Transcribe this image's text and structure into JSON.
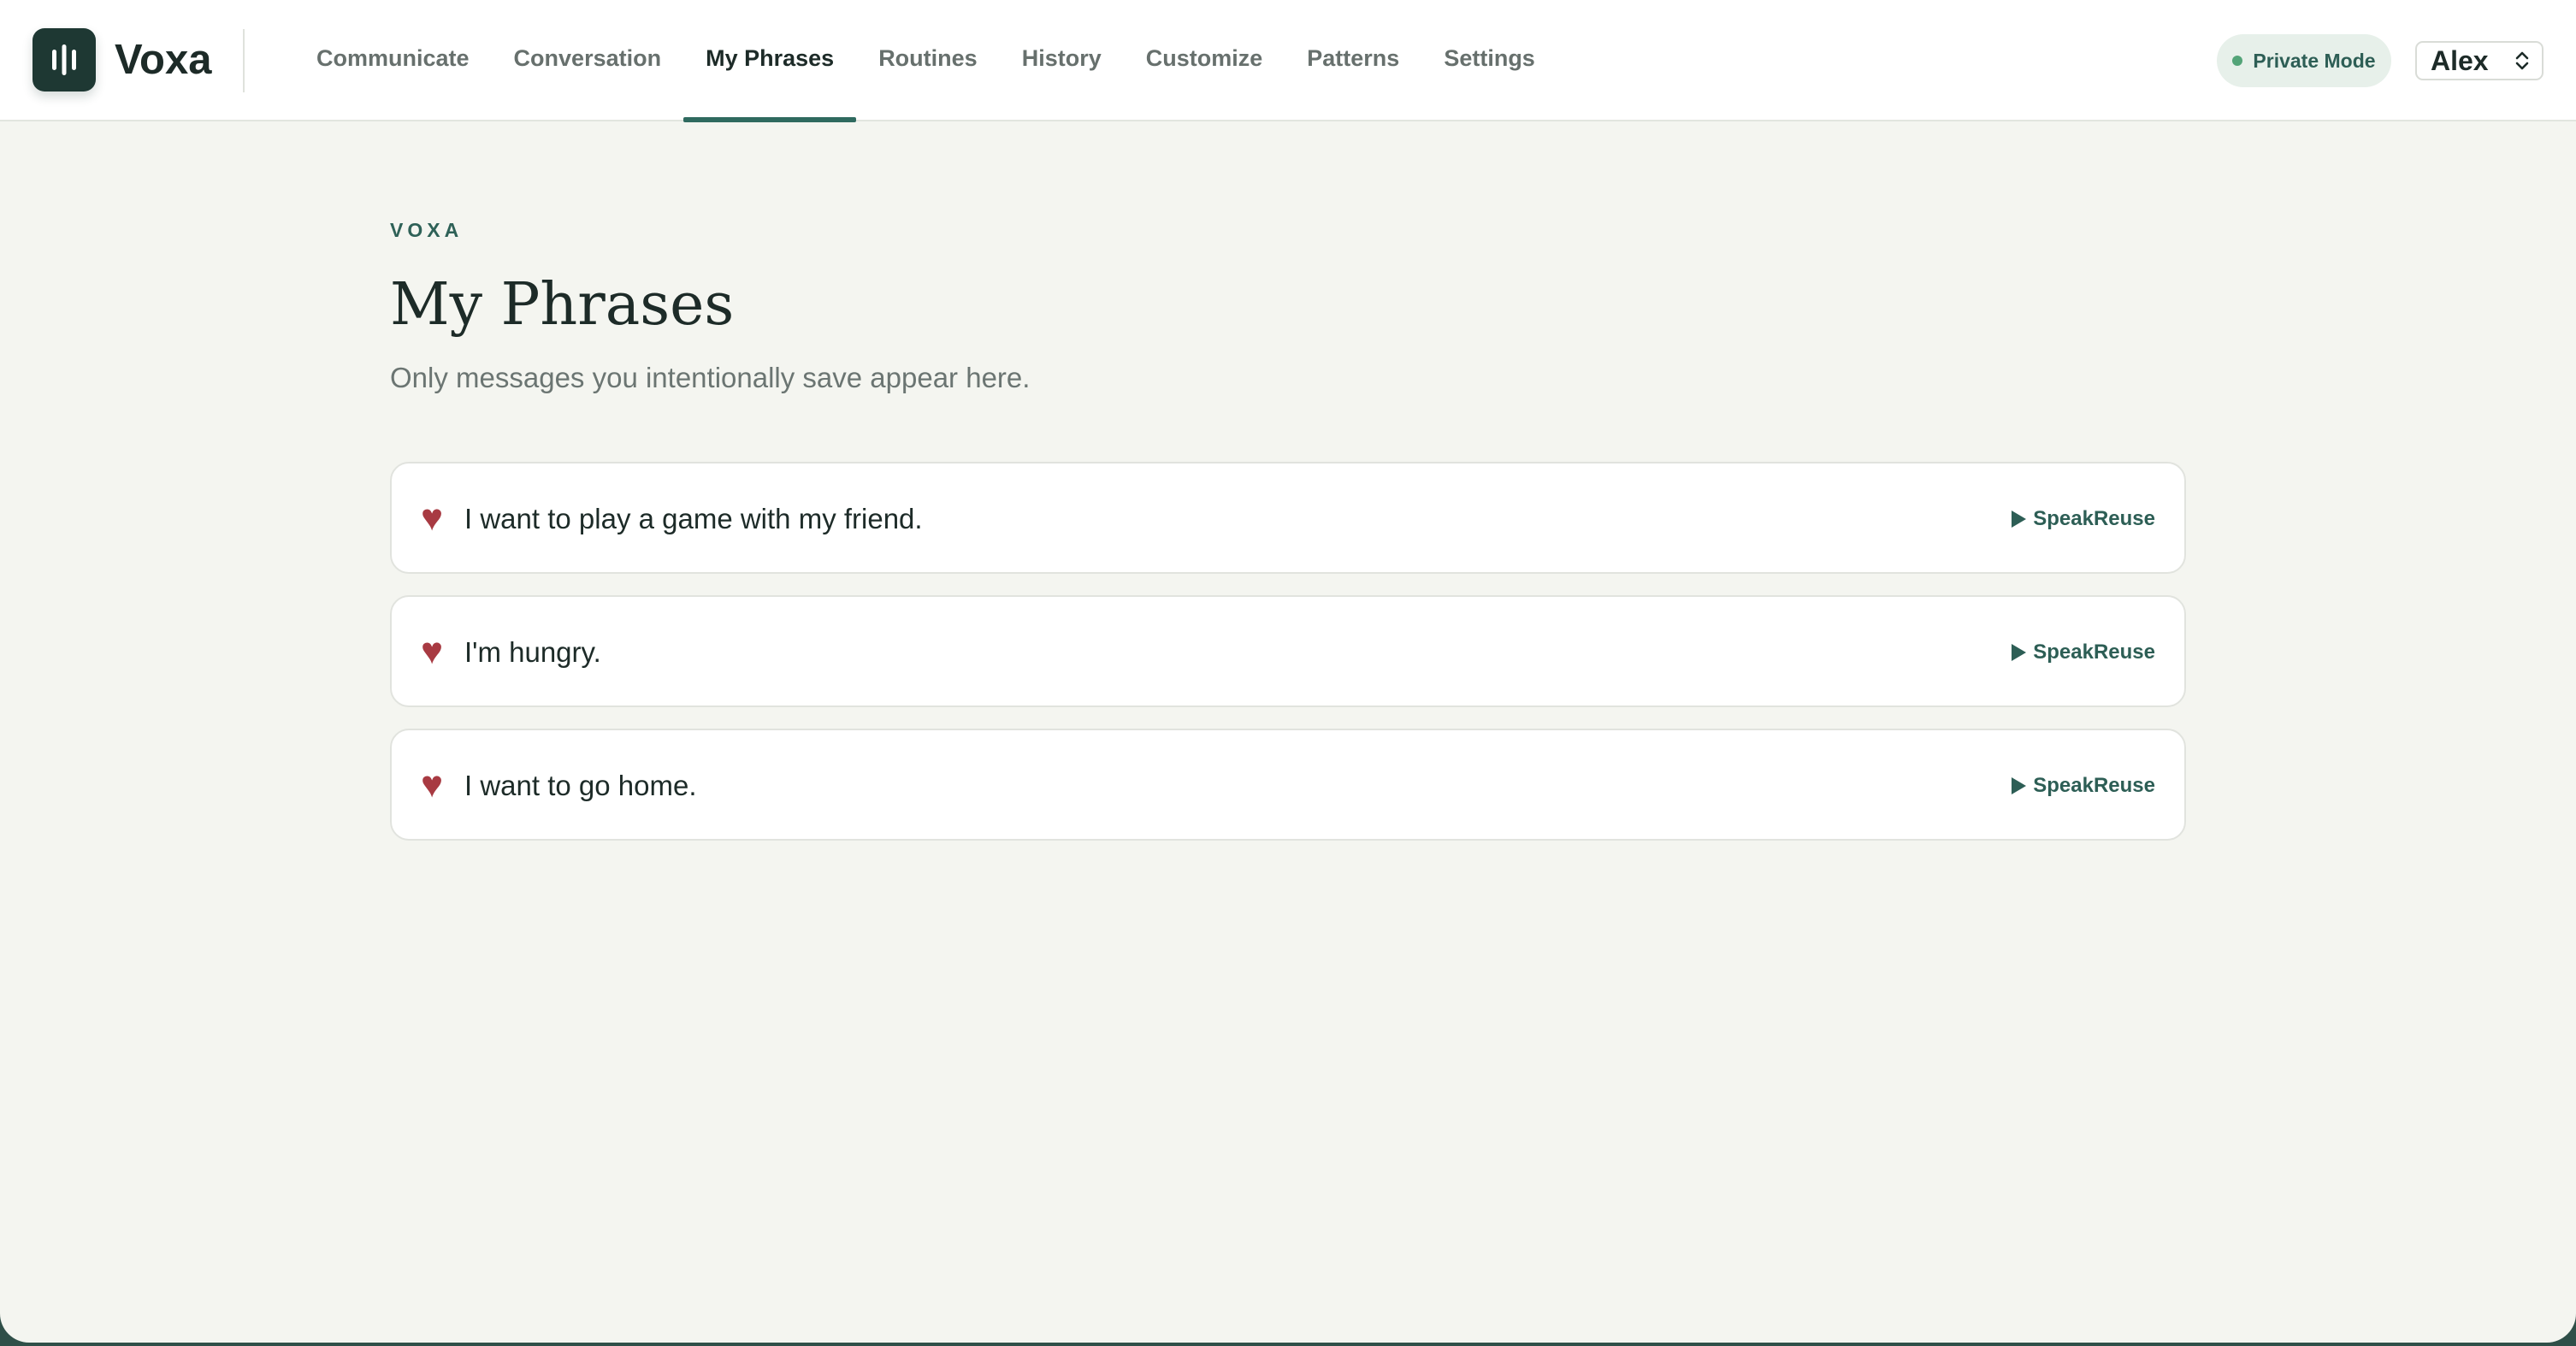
{
  "app": {
    "brand": "Voxa"
  },
  "nav": {
    "items": [
      {
        "label": "Communicate"
      },
      {
        "label": "Conversation"
      },
      {
        "label": "My Phrases",
        "active": true
      },
      {
        "label": "Routines"
      },
      {
        "label": "History"
      },
      {
        "label": "Customize"
      },
      {
        "label": "Patterns"
      },
      {
        "label": "Settings"
      }
    ]
  },
  "header": {
    "private_mode_label": "Private Mode",
    "user_selected": "Alex"
  },
  "page": {
    "eyebrow": "VOXA",
    "title": "My Phrases",
    "subtitle": "Only messages you intentionally save appear here."
  },
  "phrases": [
    {
      "text": "I want to play a game with my friend.",
      "speak_label": "Speak",
      "reuse_label": "Reuse",
      "icon": "heart-icon"
    },
    {
      "text": "I'm hungry.",
      "speak_label": "Speak",
      "reuse_label": "Reuse",
      "icon": "heart-icon"
    },
    {
      "text": "I want to go home.",
      "speak_label": "Speak",
      "reuse_label": "Reuse",
      "icon": "heart-icon"
    }
  ],
  "colors": {
    "accent": "#2f6a5f",
    "logo_bg": "#1e3833",
    "heart": "#a83a42",
    "page_bg": "#f4f5f0",
    "private_dot": "#53a478"
  }
}
